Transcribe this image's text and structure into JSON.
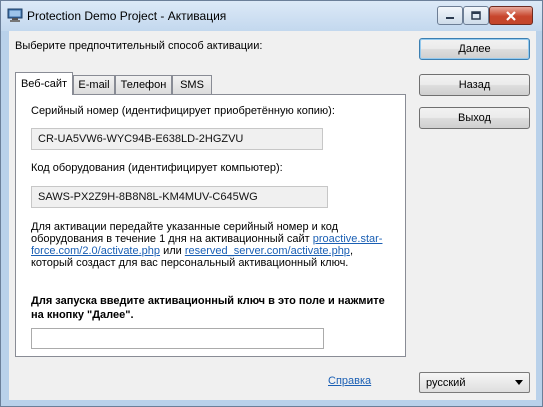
{
  "window": {
    "title": "Protection Demo Project - Активация"
  },
  "prompt": "Выберите предпочтительный способ активации:",
  "tabs": [
    {
      "label": "Веб-сайт",
      "active": true
    },
    {
      "label": "E-mail",
      "active": false
    },
    {
      "label": "Телефон",
      "active": false
    },
    {
      "label": "SMS",
      "active": false
    }
  ],
  "buttons": {
    "next": "Далее",
    "back": "Назад",
    "exit": "Выход"
  },
  "serial": {
    "label": "Серийный номер (идентифицирует приобретённую копию):",
    "value": "CR-UA5VW6-WYC94B-E638LD-2HGZVU"
  },
  "hardware": {
    "label": "Код оборудования (идентифицирует компьютер):",
    "value": "SAWS-PX2Z9H-8B8N8L-KM4MUV-C645WG"
  },
  "info": {
    "text_before": "Для активации передайте указанные серийный номер и код оборудования в течение 1 дня на активационный сайт ",
    "link1": "proactive.star-force.com/2.0/activate.php",
    "text_middle": " или ",
    "link2": "reserved_server.com/activate.php",
    "text_after": ", который создаст для вас персональный активационный ключ."
  },
  "key_prompt": "Для запуска введите активационный ключ в это поле и нажмите на кнопку \"Далее\".",
  "key_input": {
    "value": "",
    "placeholder": ""
  },
  "help_link": "Справка",
  "language": {
    "selected": "русский"
  },
  "colors": {
    "accent_link": "#1a5fb4",
    "titlebar": "#c3d8ee",
    "close_button": "#c8462d"
  }
}
